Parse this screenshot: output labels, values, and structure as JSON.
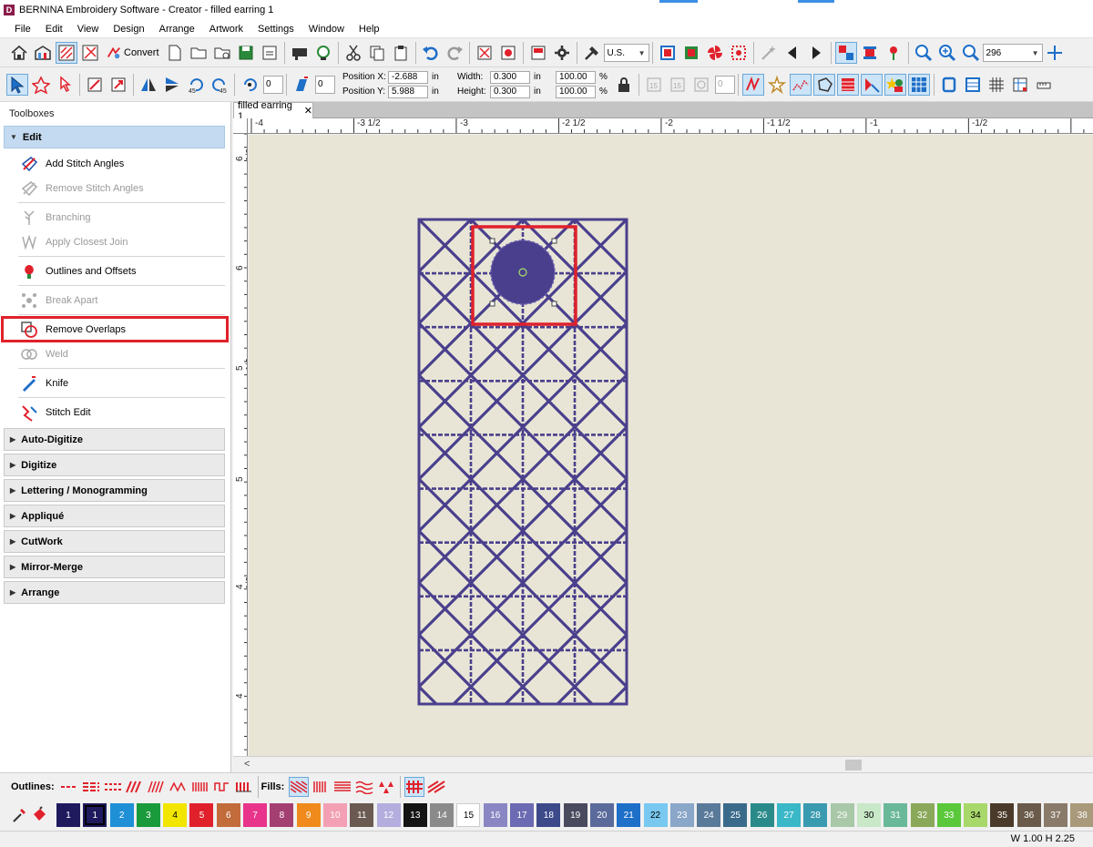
{
  "window": {
    "title": "BERNINA Embroidery Software - Creator - filled earring 1",
    "app_icon": "D"
  },
  "menu": [
    "File",
    "Edit",
    "View",
    "Design",
    "Arrange",
    "Artwork",
    "Settings",
    "Window",
    "Help"
  ],
  "toolbar1": {
    "convert_label": "Convert",
    "units_value": "U.S.",
    "zoom_value": "296"
  },
  "toolbar2": {
    "rotate_value": "0",
    "slant_value": "0",
    "position_x_label": "Position X:",
    "position_x_value": "-2.688",
    "position_y_label": "Position Y:",
    "position_y_value": "5.988",
    "width_label": "Width:",
    "width_value": "0.300",
    "height_label": "Height:",
    "height_value": "0.300",
    "unit_in": "in",
    "scale_w_value": "100.00",
    "scale_h_value": "100.00",
    "percent": "%",
    "lock_value": "0"
  },
  "toolboxes": {
    "header": "Toolboxes",
    "edit_section": "Edit",
    "edit_tools": [
      {
        "label": "Add Stitch Angles",
        "icon": "add-stitch-angles-icon",
        "disabled": false
      },
      {
        "label": "Remove Stitch Angles",
        "icon": "remove-stitch-angles-icon",
        "disabled": true
      },
      {
        "label": "Branching",
        "icon": "branching-icon",
        "disabled": true
      },
      {
        "label": "Apply Closest Join",
        "icon": "closest-join-icon",
        "disabled": true
      },
      {
        "label": "Outlines and Offsets",
        "icon": "outlines-offsets-icon",
        "disabled": false
      },
      {
        "label": "Break Apart",
        "icon": "break-apart-icon",
        "disabled": true
      },
      {
        "label": "Remove Overlaps",
        "icon": "remove-overlaps-icon",
        "disabled": false
      },
      {
        "label": "Weld",
        "icon": "weld-icon",
        "disabled": true
      },
      {
        "label": "Knife",
        "icon": "knife-icon",
        "disabled": false
      },
      {
        "label": "Stitch Edit",
        "icon": "stitch-edit-icon",
        "disabled": false
      }
    ],
    "sections": [
      "Auto-Digitize",
      "Digitize",
      "Lettering / Monogramming",
      "Appliqué",
      "CutWork",
      "Mirror-Merge",
      "Arrange"
    ]
  },
  "document": {
    "tab_label": "filled earring 1",
    "close_glyph": "✕",
    "h_ruler_labels": [
      "-4",
      "-3 1/2",
      "-3",
      "-2 1/2",
      "-2",
      "-1 1/2",
      "-1",
      "-1/2"
    ],
    "v_ruler_labels": [
      "6 1/2",
      "6",
      "5 1/2",
      "5",
      "4 1/2",
      "4"
    ],
    "stitch_color": "#4a3f8c",
    "selection_color": "#e0212b",
    "canvas_color": "#e8e5d6"
  },
  "bottom": {
    "outlines_label": "Outlines:",
    "fills_label": "Fills:"
  },
  "palette": [
    {
      "n": "1",
      "c": "#1f1a5e",
      "t": "#fff"
    },
    {
      "n": "1",
      "c": "#1f1a5e",
      "t": "#fff",
      "sel": true
    },
    {
      "n": "2",
      "c": "#1f8fd6",
      "t": "#fff"
    },
    {
      "n": "3",
      "c": "#1a9a3a",
      "t": "#fff"
    },
    {
      "n": "4",
      "c": "#f2e600",
      "t": "#000"
    },
    {
      "n": "5",
      "c": "#e0212b",
      "t": "#fff"
    },
    {
      "n": "6",
      "c": "#c26b3b",
      "t": "#fff"
    },
    {
      "n": "7",
      "c": "#e8348a",
      "t": "#fff"
    },
    {
      "n": "8",
      "c": "#a43f72",
      "t": "#fff"
    },
    {
      "n": "9",
      "c": "#f08a1c",
      "t": "#fff"
    },
    {
      "n": "10",
      "c": "#f4a0b4",
      "t": "#fff"
    },
    {
      "n": "11",
      "c": "#6a5a52",
      "t": "#fff"
    },
    {
      "n": "12",
      "c": "#b4aede",
      "t": "#fff"
    },
    {
      "n": "13",
      "c": "#141414",
      "t": "#fff"
    },
    {
      "n": "14",
      "c": "#8a8a8a",
      "t": "#fff"
    },
    {
      "n": "15",
      "c": "#ffffff",
      "t": "#000"
    },
    {
      "n": "16",
      "c": "#8a86c4",
      "t": "#fff"
    },
    {
      "n": "17",
      "c": "#6c6ab2",
      "t": "#fff"
    },
    {
      "n": "18",
      "c": "#3c4a8a",
      "t": "#fff"
    },
    {
      "n": "19",
      "c": "#4a4a5e",
      "t": "#fff"
    },
    {
      "n": "20",
      "c": "#5a6a9a",
      "t": "#fff"
    },
    {
      "n": "21",
      "c": "#1e6fc8",
      "t": "#fff"
    },
    {
      "n": "22",
      "c": "#78c8f0",
      "t": "#000"
    },
    {
      "n": "23",
      "c": "#8aa6c8",
      "t": "#fff"
    },
    {
      "n": "24",
      "c": "#5a7a9a",
      "t": "#fff"
    },
    {
      "n": "25",
      "c": "#3a6a8a",
      "t": "#fff"
    },
    {
      "n": "26",
      "c": "#2a8a8a",
      "t": "#fff"
    },
    {
      "n": "27",
      "c": "#3ab8c8",
      "t": "#fff"
    },
    {
      "n": "28",
      "c": "#3a9ab0",
      "t": "#fff"
    },
    {
      "n": "29",
      "c": "#a8c8a8",
      "t": "#fff"
    },
    {
      "n": "30",
      "c": "#c8e8c8",
      "t": "#000"
    },
    {
      "n": "31",
      "c": "#6ab89a",
      "t": "#fff"
    },
    {
      "n": "32",
      "c": "#8aa85a",
      "t": "#fff"
    },
    {
      "n": "33",
      "c": "#5ac83a",
      "t": "#fff"
    },
    {
      "n": "34",
      "c": "#a8d86a",
      "t": "#000"
    },
    {
      "n": "35",
      "c": "#4a3a2a",
      "t": "#fff"
    },
    {
      "n": "36",
      "c": "#6a5a4a",
      "t": "#fff"
    },
    {
      "n": "37",
      "c": "#8a7a6a",
      "t": "#fff"
    },
    {
      "n": "38",
      "c": "#a89a7a",
      "t": "#fff"
    }
  ],
  "status": {
    "dims": "W 1.00 H 2.25"
  }
}
